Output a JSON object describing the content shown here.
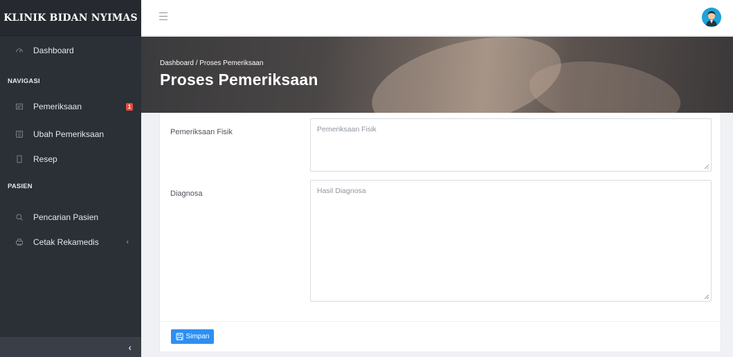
{
  "app": {
    "brand": "KLINIK BIDAN NYIMAS"
  },
  "sidebar": {
    "dashboard": {
      "label": "Dashboard",
      "icon": "dashboard-icon"
    },
    "sections": {
      "navigasi": "NAVIGASI",
      "pasien": "PASIEN"
    },
    "items": [
      {
        "label": "Pemeriksaan",
        "icon": "clipboard-icon",
        "badge": "1"
      },
      {
        "label": "Ubah Pemeriksaan",
        "icon": "edit-icon"
      },
      {
        "label": "Resep",
        "icon": "document-icon"
      },
      {
        "label": "Pencarian Pasien",
        "icon": "search-icon"
      },
      {
        "label": "Cetak Rekamedis",
        "icon": "print-icon",
        "chevron": "‹"
      }
    ],
    "collapse_icon": "‹"
  },
  "topbar": {
    "menu_icon": "hamburger-icon",
    "avatar": "user-avatar"
  },
  "hero": {
    "breadcrumb": "Dashboard / Proses Pemeriksaan",
    "title": "Proses Pemeriksaan"
  },
  "form": {
    "pemeriksaan_fisik": {
      "label": "Pemeriksaan Fisik",
      "placeholder": "Pemeriksaan Fisik",
      "value": ""
    },
    "diagnosa": {
      "label": "Diagnosa",
      "placeholder": "Hasil Diagnosa",
      "value": ""
    },
    "save_label": "Simpan"
  },
  "colors": {
    "sidebar_bg": "#2b2f36",
    "primary": "#2d8ff2",
    "badge": "#e84a3d",
    "avatar": "#1ea2d9"
  }
}
